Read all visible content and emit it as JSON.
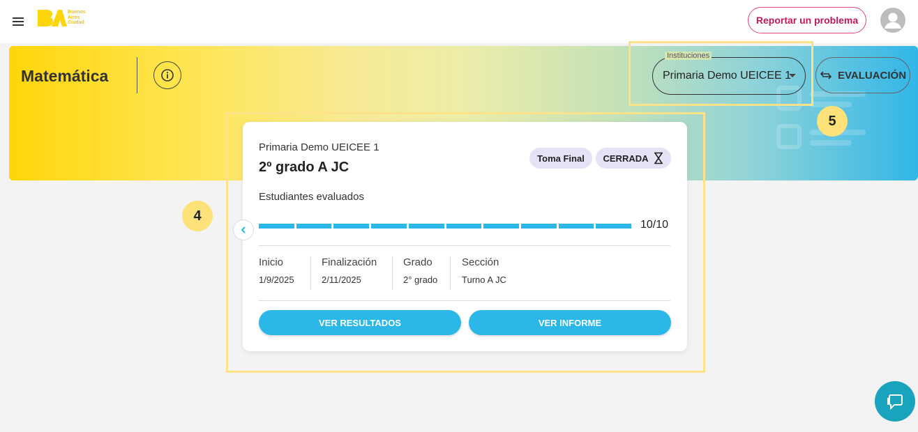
{
  "topbar": {
    "logo_text": "Buenos\nAires\nCiudad",
    "report_label": "Reportar un problema"
  },
  "banner": {
    "title": "Matemática",
    "institutions_label": "Instituciones",
    "institution_selected": "Primaria Demo UEICEE 1",
    "eval_label": "EVALUACIÓN"
  },
  "markers": {
    "four": "4",
    "five": "5"
  },
  "card": {
    "institution": "Primaria Demo UEICEE 1",
    "grade_title": "2º grado A JC",
    "chip_type": "Toma Final",
    "chip_status": "CERRADA",
    "students_label": "Estudiantes evaluados",
    "evaluated": 10,
    "total": 10,
    "progress_text": "10/10",
    "info": {
      "start_label": "Inicio",
      "start_value": "1/9/2025",
      "end_label": "Finalización",
      "end_value": "2/11/2025",
      "grade_label": "Grado",
      "grade_value": "2° grado",
      "section_label": "Sección",
      "section_value": "Turno A JC"
    },
    "results_label": "VER RESULTADOS",
    "report_label": "VER INFORME"
  },
  "colors": {
    "accent": "#2bb7e8",
    "highlight": "#fde28a",
    "brand_yellow": "#ffd60a",
    "report_pink": "#c2185b",
    "chat": "#1aa3bd"
  },
  "icons": {
    "menu": "menu-icon",
    "info": "info-icon",
    "swap": "swap-icon",
    "hourglass": "hourglass-icon",
    "chevron": "chevron-left-icon",
    "chat": "chat-icon",
    "avatar": "person-icon"
  }
}
